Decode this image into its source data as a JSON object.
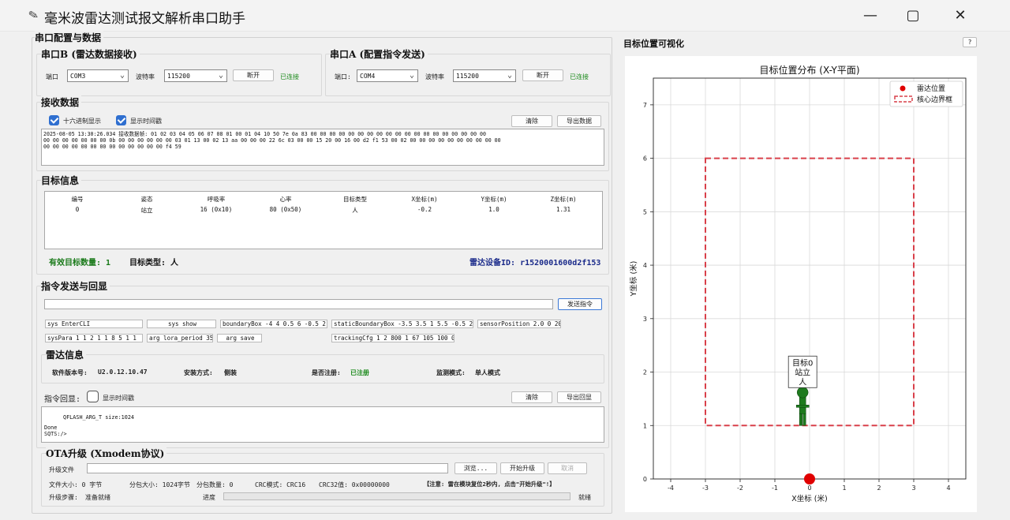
{
  "window": {
    "title": "毫米波雷达测试报文解析串口助手",
    "minimize": "—",
    "maximize": "▢",
    "close": "✕"
  },
  "left": {
    "section_title": "串口配置与数据",
    "portB": {
      "title": "串口B (雷达数据接收)",
      "port_label": "端口",
      "port_value": "COM3",
      "baud_label": "波特率",
      "baud_value": "115200",
      "button": "断开",
      "status": "已连接"
    },
    "portA": {
      "title": "串口A (配置指令发送)",
      "port_label": "端口:",
      "port_value": "COM4",
      "baud_label": "波特率",
      "baud_value": "115200",
      "button": "断开",
      "status": "已连接"
    },
    "receive": {
      "title": "接收数据",
      "hex_label": "十六进制显示",
      "hex_checked": true,
      "time_label": "显示时间戳",
      "time_checked": true,
      "clear": "清除",
      "export": "导出数据",
      "lines": [
        "2025-08-05 13:30:26.034 接收数据帧: 01 02 03 04 05 06 07 08 01 00 01 04 10 50 7e 0a 83 00 00 00 00 00 00 00 00 00 00 00 00 00 00 00 00 00 00 00",
        "00 00 00 00 00 00 00 0b 00 00 00 00 00 00 03 01 13 00 02 13 aa 00 00 00 22 6c 03 00 00 15 20 00 16 00 d2 f1 53 00 02 00 00 00 00 00 00 00 00 00 00",
        "00 00 00 00 00 00 00 00 00 00 00 00 00 f4 59"
      ]
    },
    "targets": {
      "title": "目标信息",
      "headers": [
        "编号",
        "姿态",
        "呼吸率",
        "心率",
        "目标类型",
        "X坐标(m)",
        "Y坐标(m)",
        "Z坐标(m)"
      ],
      "rows": [
        [
          "0",
          "站立",
          "16 (0x10)",
          "80 (0x50)",
          "人",
          "-0.2",
          "1.0",
          "1.31"
        ]
      ],
      "count_text": "有效目标数量: 1",
      "type_text": "目标类型: 人",
      "device_text": "雷达设备ID: r1520001600d2f153"
    },
    "cmd": {
      "title": "指令发送与回显",
      "send_value": "",
      "send_button": "发送指令",
      "quick": [
        "sys EnterCLI",
        "sys show",
        "boundaryBox -4 4 0.5 6 -0.5 2",
        "staticBoundaryBox -3.5 3.5 1 5.5 -0.5 2",
        "sensorPosition 2.0 0 20",
        "sysPara 1 1 2 1 1 8 5 1 1",
        "arg lora_period 35",
        "arg save",
        "trackingCfg 1 2 800 1 67 105 100 0"
      ],
      "radar_title": "雷达信息",
      "fw_label": "软件版本号:",
      "fw_value": "U2.0.12.10.47",
      "mount_label": "安装方式:",
      "mount_value": "侧装",
      "reg_label": "是否注册:",
      "reg_value": "已注册",
      "mode_label": "监测模式:",
      "mode_value": "单人模式",
      "echo_label": "指令回显:",
      "echo_time_label": "显示时间戳",
      "echo_time_checked": false,
      "echo_clear": "清除",
      "echo_export": "导出回显",
      "echo_lines": [
        "QFLASH_ARG_T size:1024",
        "",
        "Done",
        "SQTS:/>"
      ]
    },
    "ota": {
      "title": "OTA升级 (Xmodem协议)",
      "file_label": "升级文件",
      "file_value": "",
      "browse": "浏览...",
      "start": "开始升级",
      "cancel": "取消",
      "size_text": "文件大小: 0 字节",
      "packet_text": "分包大小: 1024字节",
      "count_text": "分包数量: 0",
      "crc_mode_text": "CRC模式: CRC16",
      "crc32_text": "CRC32值: 0x00000000",
      "notice": "【注意: 雷在模块复位2秒内, 点击\"开始升级\"!】",
      "step_label": "升级步骤:",
      "step_value": "准备就绪",
      "progress_label": "进度",
      "progress": 0,
      "status": "就绪"
    }
  },
  "right": {
    "section_title": "目标位置可视化",
    "help": "?"
  },
  "chart_data": {
    "type": "scatter",
    "title": "目标位置分布 (X-Y平面)",
    "xlabel": "X坐标 (米)",
    "ylabel": "Y坐标 (米)",
    "xlim": [
      -4.5,
      4.5
    ],
    "ylim": [
      0,
      7.5
    ],
    "xticks": [
      -4,
      -3,
      -2,
      -1,
      0,
      1,
      2,
      3,
      4
    ],
    "yticks": [
      0,
      1,
      2,
      3,
      4,
      5,
      6,
      7
    ],
    "grid": true,
    "legend": "top-right",
    "legend_entries": [
      "雷达位置",
      "核心边界框"
    ],
    "radar": {
      "x": 0,
      "y": 0,
      "color": "#e00000"
    },
    "boundary": {
      "x": [
        -3,
        3
      ],
      "y": [
        1,
        6
      ],
      "color": "#d9404a"
    },
    "targets": [
      {
        "x": -0.2,
        "y": 1.0,
        "label_lines": [
          "目标0",
          "站立",
          "人"
        ],
        "color": "#1e7a1e"
      }
    ]
  }
}
